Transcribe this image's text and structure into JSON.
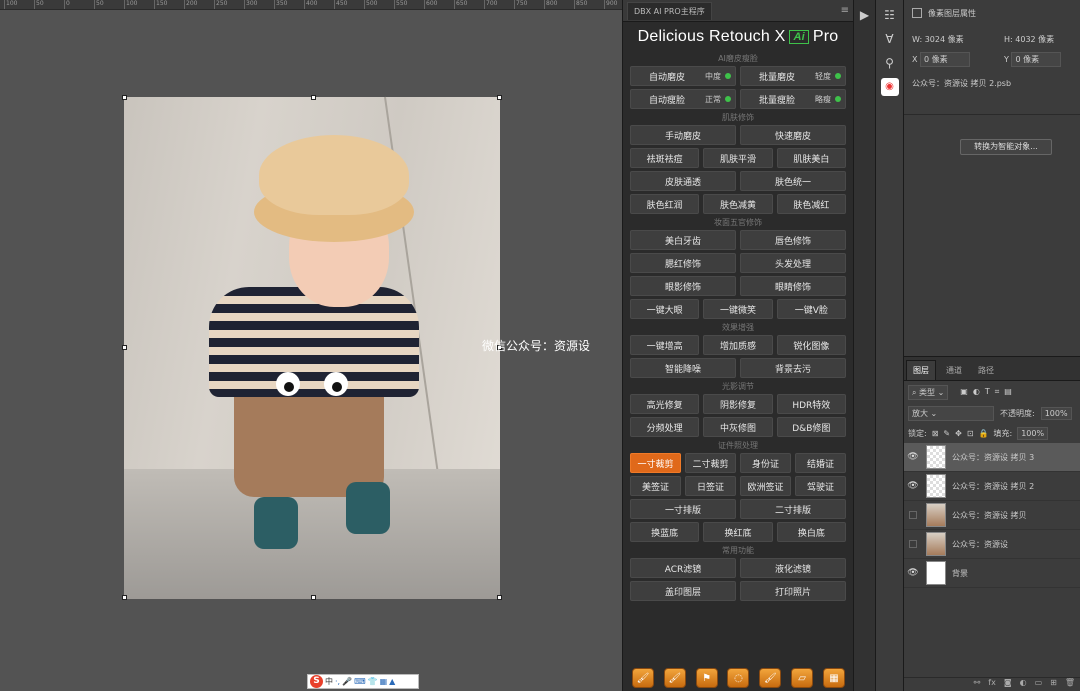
{
  "ruler": {
    "ticks": [
      "100",
      "50",
      "0",
      "50",
      "100",
      "150",
      "200",
      "250",
      "300",
      "350",
      "400",
      "450",
      "500",
      "550",
      "600",
      "650",
      "700",
      "750",
      "800",
      "850",
      "900"
    ]
  },
  "canvas": {
    "watermark": "微信公众号：资源设"
  },
  "ime": {
    "logo": "S",
    "label": "中",
    "icons": [
      "·,",
      "🎤",
      "⌨",
      "👕",
      "▦",
      "▲"
    ]
  },
  "plugin": {
    "tab_label": "DBX AI PRO主程序",
    "menu_icon": "hamburger-icon",
    "title_left": "Delicious Retouch X",
    "title_badge": "Ai",
    "title_right": "Pro",
    "sections": [
      {
        "title": "AI磨皮瘦脸",
        "rows": [
          [
            {
              "label": "自动磨皮",
              "sub": "中度",
              "dot": true
            },
            {
              "label": "批量磨皮",
              "sub": "轻度",
              "dot": true
            }
          ],
          [
            {
              "label": "自动瘦脸",
              "sub": "正常",
              "dot": true
            },
            {
              "label": "批量瘦脸",
              "sub": "略瘦",
              "dot": true
            }
          ]
        ]
      },
      {
        "title": "肌肤修饰",
        "rows": [
          [
            {
              "label": "手动磨皮"
            },
            {
              "label": "快速磨皮"
            }
          ],
          [
            {
              "label": "祛斑祛痘"
            },
            {
              "label": "肌肤平滑"
            },
            {
              "label": "肌肤美白"
            }
          ],
          [
            {
              "label": "皮肤通透"
            },
            {
              "label": "肤色统一"
            }
          ],
          [
            {
              "label": "肤色红润"
            },
            {
              "label": "肤色减黄"
            },
            {
              "label": "肤色减红"
            }
          ]
        ]
      },
      {
        "title": "妆面五官修饰",
        "rows": [
          [
            {
              "label": "美白牙齿"
            },
            {
              "label": "唇色修饰"
            }
          ],
          [
            {
              "label": "腮红修饰"
            },
            {
              "label": "头发处理"
            }
          ],
          [
            {
              "label": "眼影修饰"
            },
            {
              "label": "眼睛修饰"
            }
          ],
          [
            {
              "label": "一键大眼"
            },
            {
              "label": "一键微笑"
            },
            {
              "label": "一键V脸"
            }
          ]
        ]
      },
      {
        "title": "效果增强",
        "rows": [
          [
            {
              "label": "一键增高"
            },
            {
              "label": "增加质感"
            },
            {
              "label": "锐化图像"
            }
          ],
          [
            {
              "label": "智能降噪"
            },
            {
              "label": "背景去污"
            }
          ]
        ]
      },
      {
        "title": "光影调节",
        "rows": [
          [
            {
              "label": "高光修复"
            },
            {
              "label": "阴影修复"
            },
            {
              "label": "HDR特效"
            }
          ],
          [
            {
              "label": "分频处理"
            },
            {
              "label": "中灰修图"
            },
            {
              "label": "D&B修图"
            }
          ]
        ]
      },
      {
        "title": "证件照处理",
        "rows": [
          [
            {
              "label": "一寸裁剪",
              "active": true
            },
            {
              "label": "二寸裁剪"
            },
            {
              "label": "身份证"
            },
            {
              "label": "结婚证"
            }
          ],
          [
            {
              "label": "美签证"
            },
            {
              "label": "日签证"
            },
            {
              "label": "欧洲签证"
            },
            {
              "label": "驾驶证"
            }
          ],
          [
            {
              "label": "一寸排版"
            },
            {
              "label": "二寸排版"
            }
          ],
          [
            {
              "label": "换蓝底"
            },
            {
              "label": "换红底"
            },
            {
              "label": "换白底"
            }
          ]
        ]
      },
      {
        "title": "常用功能",
        "rows": [
          [
            {
              "label": "ACR滤镜"
            },
            {
              "label": "液化滤镜"
            }
          ],
          [
            {
              "label": "盖印图层"
            },
            {
              "label": "打印照片"
            }
          ]
        ]
      }
    ],
    "bottom_tools": [
      "brush-icon",
      "brush-icon",
      "stamp-icon",
      "lasso-icon",
      "brush-icon",
      "eraser-icon",
      "chip-icon"
    ]
  },
  "properties": {
    "header": "像素图层属性",
    "w_label": "W:",
    "w_value": "3024 像素",
    "h_label": "H:",
    "h_value": "4032 像素",
    "x_label": "X",
    "x_value": "0 像素",
    "y_label": "Y",
    "y_value": "0 像素",
    "filename": "公众号：资源设 拷贝 2.psb",
    "convert_button": "转换为智能对象..."
  },
  "layers": {
    "tabs": [
      "图层",
      "通道",
      "路径"
    ],
    "filter_label": "类型",
    "blend_mode": "放大",
    "opacity_label": "不透明度:",
    "opacity_value": "100%",
    "lock_label": "锁定:",
    "fill_label": "填充:",
    "fill_value": "100%",
    "items": [
      {
        "name": "公众号：资源设 拷贝 3",
        "visible": true,
        "selected": true,
        "thumb": "chk"
      },
      {
        "name": "公众号：资源设 拷贝 2",
        "visible": true,
        "selected": false,
        "thumb": "chk"
      },
      {
        "name": "公众号：资源设 拷贝",
        "visible": false,
        "selected": false,
        "thumb": "photo-t"
      },
      {
        "name": "公众号：资源设",
        "visible": false,
        "selected": false,
        "thumb": "photo-t"
      },
      {
        "name": "背景",
        "visible": true,
        "selected": false,
        "thumb": "white"
      }
    ]
  }
}
